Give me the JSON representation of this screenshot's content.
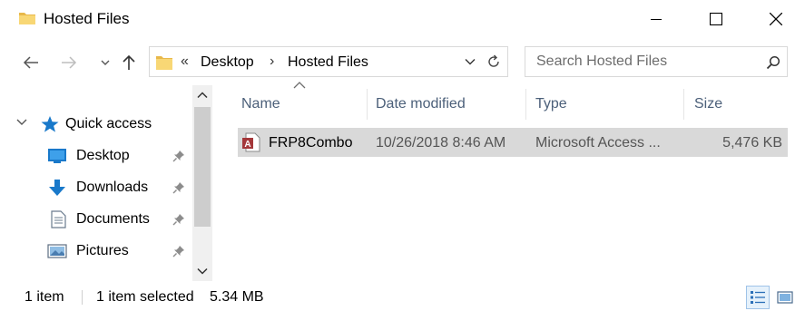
{
  "window": {
    "title": "Hosted Files"
  },
  "nav": {
    "breadcrumb_prefix": "«",
    "crumbs": [
      "Desktop",
      "Hosted Files"
    ],
    "crumb_sep": "›"
  },
  "search": {
    "placeholder": "Search Hosted Files"
  },
  "sidebar": {
    "quick_access": "Quick access",
    "items": [
      {
        "label": "Desktop",
        "icon": "desktop-icon"
      },
      {
        "label": "Downloads",
        "icon": "download-arrow-icon"
      },
      {
        "label": "Documents",
        "icon": "document-icon"
      },
      {
        "label": "Pictures",
        "icon": "picture-icon"
      }
    ]
  },
  "columns": {
    "name": "Name",
    "date": "Date modified",
    "type": "Type",
    "size": "Size"
  },
  "files": [
    {
      "name": "FRP8Combo",
      "date": "10/26/2018 8:46 AM",
      "type": "Microsoft Access ...",
      "size": "5,476 KB",
      "icon": "access-database-icon"
    }
  ],
  "status": {
    "count": "1 item",
    "selected": "1 item selected",
    "size": "5.34 MB"
  },
  "colors": {
    "folder": "#f8d775",
    "folder_dark": "#e8b84a",
    "accent_blue": "#1979ca",
    "selection": "#d9d9d9",
    "header_text": "#4c607a",
    "access_red": "#a4373a"
  }
}
